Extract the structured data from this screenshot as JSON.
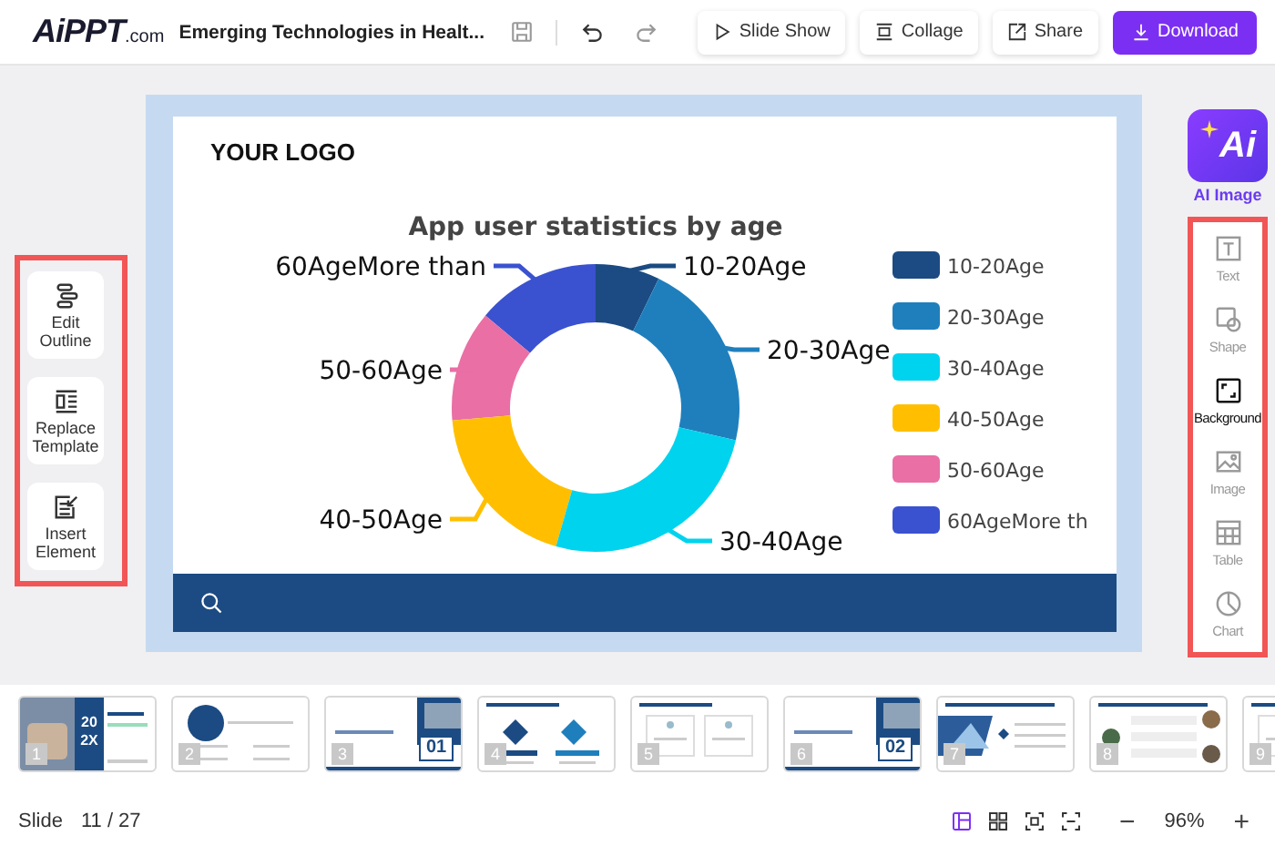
{
  "header": {
    "logo": {
      "main": "AiPPT",
      "suffix": ".com"
    },
    "title": "Emerging Technologies in Healt...",
    "buttons": [
      {
        "label": "Slide Show",
        "kind": "play"
      },
      {
        "label": "Collage",
        "kind": "collage"
      },
      {
        "label": "Share",
        "kind": "share"
      },
      {
        "label": "Download",
        "kind": "download"
      }
    ]
  },
  "left_tools": [
    {
      "label": "Edit Outline",
      "kind": "outline"
    },
    {
      "label": "Replace Template",
      "kind": "template"
    },
    {
      "label": "Insert Element",
      "kind": "insert"
    }
  ],
  "slide": {
    "logo_text": "YOUR LOGO",
    "chart": {
      "title": "App user statistics by age",
      "slices": [
        {
          "label": "60AgeMore than",
          "color": "#3a52cf"
        },
        {
          "label": "10-20Age",
          "color": "#1b4b82"
        },
        {
          "label": "20-30Age",
          "color": "#1f7fbd"
        },
        {
          "label": "50-60Age",
          "color": "#e96fa5"
        },
        {
          "label": "40-50Age",
          "color": "#ffbf00"
        },
        {
          "label": "30-40Age",
          "color": "#00d3ee"
        }
      ],
      "legend": [
        {
          "label": "10-20Age",
          "color": "#1b4b82"
        },
        {
          "label": "20-30Age",
          "color": "#1f7fbd"
        },
        {
          "label": "30-40Age",
          "color": "#00d3ee"
        },
        {
          "label": "40-50Age",
          "color": "#ffbf00"
        },
        {
          "label": "50-60Age",
          "color": "#e96fa5"
        },
        {
          "label": "60AgeMore th",
          "color": "#3a52cf"
        }
      ]
    }
  },
  "right_panel": {
    "ai_button": {
      "label": "AI Image",
      "badge": "Ai"
    },
    "tools": [
      {
        "label": "Text",
        "kind": "text",
        "selected": false
      },
      {
        "label": "Shape",
        "kind": "shape",
        "selected": false
      },
      {
        "label": "Background",
        "kind": "background",
        "selected": true
      },
      {
        "label": "Image",
        "kind": "image",
        "selected": false
      },
      {
        "label": "Table",
        "kind": "table",
        "selected": false
      },
      {
        "label": "Chart",
        "kind": "chart",
        "selected": false
      }
    ]
  },
  "thumbnails": [
    {
      "number": "1",
      "kind": "cover",
      "big_text": "20 2X"
    },
    {
      "number": "2",
      "kind": "contents"
    },
    {
      "number": "3",
      "kind": "section",
      "big_text": "01"
    },
    {
      "number": "4",
      "kind": "diagram"
    },
    {
      "number": "5",
      "kind": "text"
    },
    {
      "number": "6",
      "kind": "section",
      "big_text": "02"
    },
    {
      "number": "7",
      "kind": "image"
    },
    {
      "number": "8",
      "kind": "list"
    },
    {
      "number": "9",
      "kind": "text"
    }
  ],
  "status": {
    "slide_label": "Slide",
    "slide_count": "11 / 27",
    "views": [
      {
        "kind": "normal",
        "selected": true
      },
      {
        "kind": "grid",
        "selected": false
      },
      {
        "kind": "fit",
        "selected": false
      },
      {
        "kind": "fullscreen",
        "selected": false
      }
    ],
    "zoom_out": "−",
    "zoom": "96%",
    "zoom_in": "+"
  }
}
